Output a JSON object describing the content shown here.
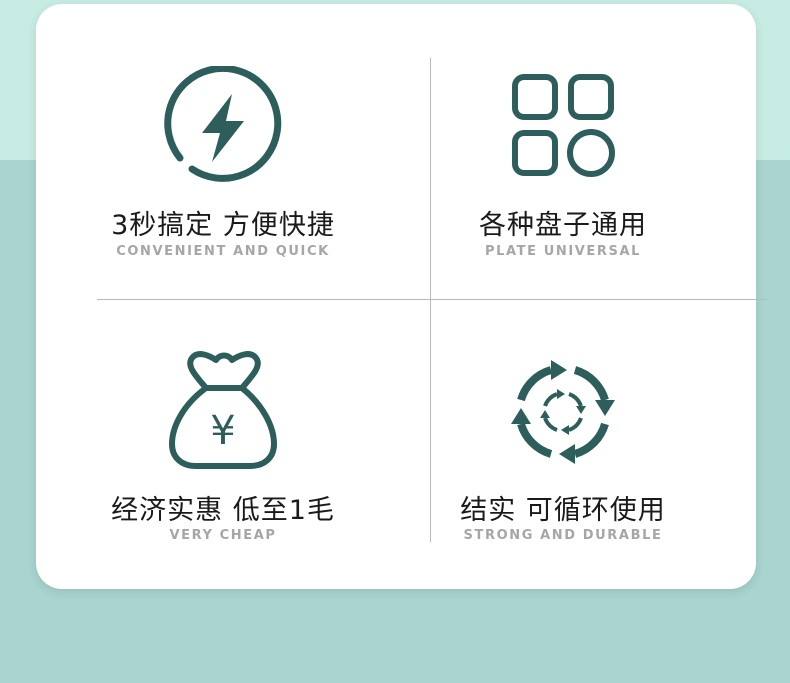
{
  "features": [
    {
      "title": "3秒搞定 方便快捷",
      "subtitle": "CONVENIENT AND QUICK",
      "icon": "lightning-circle-icon"
    },
    {
      "title": "各种盘子通用",
      "subtitle": "PLATE UNIVERSAL",
      "icon": "grid-squares-icon"
    },
    {
      "title": "经济实惠 低至1毛",
      "subtitle": "VERY CHEAP",
      "icon": "money-bag-icon",
      "icon_text": "¥"
    },
    {
      "title": "结实 可循环使用",
      "subtitle": "STRONG AND DURABLE",
      "icon": "recycle-arrows-icon"
    }
  ],
  "colors": {
    "icon": "#2e5e5c",
    "card": "#ffffff",
    "background_top": "#c7ece3",
    "background_bottom": "#a9d4cf",
    "title_text": "#1a1a1a",
    "subtitle_text": "#a6a6a6"
  }
}
